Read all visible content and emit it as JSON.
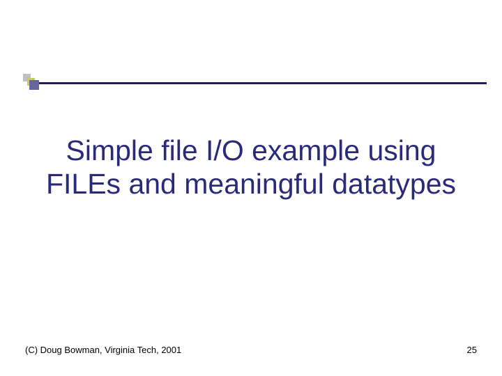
{
  "title": "Simple file I/O example using FILEs and meaningful datatypes",
  "footer": {
    "copyright": "(C) Doug Bowman, Virginia Tech, 2001",
    "page_number": "25"
  }
}
